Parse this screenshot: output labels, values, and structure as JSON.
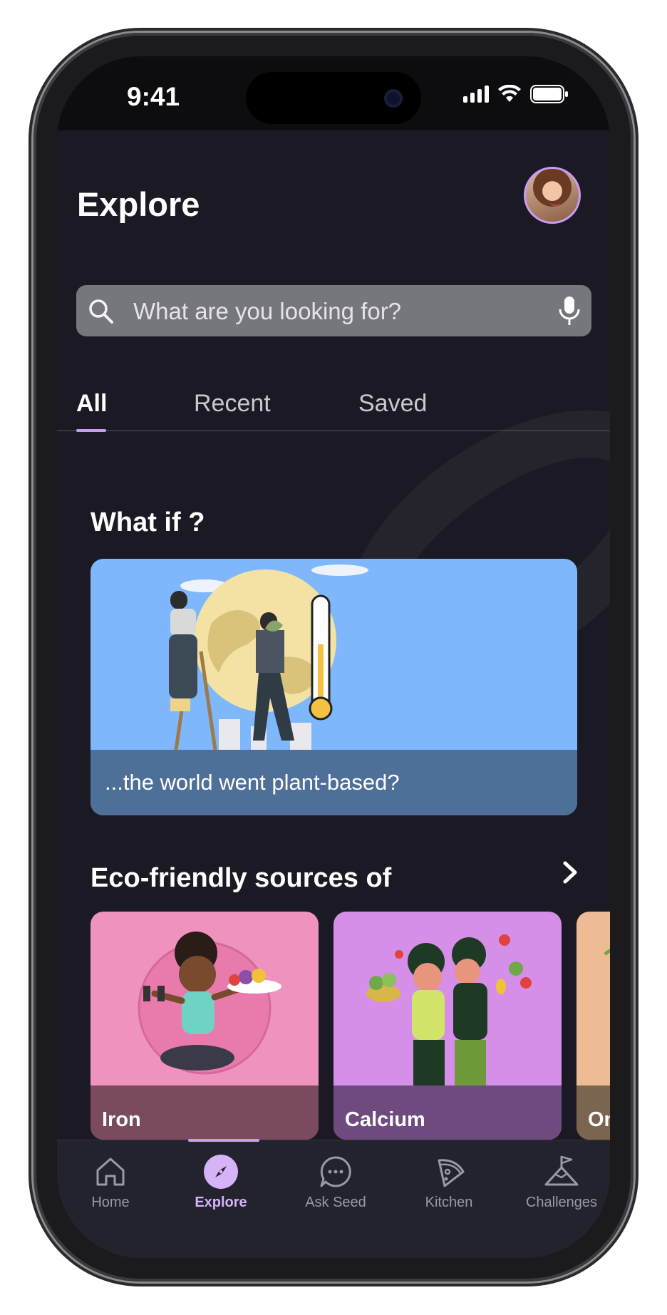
{
  "status_bar": {
    "time": "9:41"
  },
  "header": {
    "title": "Explore"
  },
  "search": {
    "placeholder": "What are you looking for?"
  },
  "tabs": [
    {
      "label": "All",
      "active": true
    },
    {
      "label": "Recent",
      "active": false
    },
    {
      "label": "Saved",
      "active": false
    }
  ],
  "what_if": {
    "title": "What if ?",
    "card_caption": "...the world went plant-based?"
  },
  "eco_sources": {
    "title": "Eco-friendly sources of",
    "cards": [
      {
        "label": "Iron",
        "color": "#ef92bd",
        "label_bg": "#7a4a5e"
      },
      {
        "label": "Calcium",
        "color": "#d68fe8",
        "label_bg": "#6e4a7e"
      },
      {
        "label": "Om",
        "color": "#edbb94",
        "label_bg": "#7b6450"
      }
    ]
  },
  "bottom_nav": {
    "items": [
      {
        "label": "Home",
        "icon": "home-icon",
        "active": false
      },
      {
        "label": "Explore",
        "icon": "compass-icon",
        "active": true
      },
      {
        "label": "Ask Seed",
        "icon": "chat-bubble-icon",
        "active": false
      },
      {
        "label": "Kitchen",
        "icon": "pizza-slice-icon",
        "active": false
      },
      {
        "label": "Challenges",
        "icon": "flag-mountain-icon",
        "active": false
      }
    ]
  },
  "colors": {
    "accent": "#c89cf2",
    "background": "#1b1a24",
    "nav_background": "#23232e",
    "search_background": "#76767d"
  }
}
